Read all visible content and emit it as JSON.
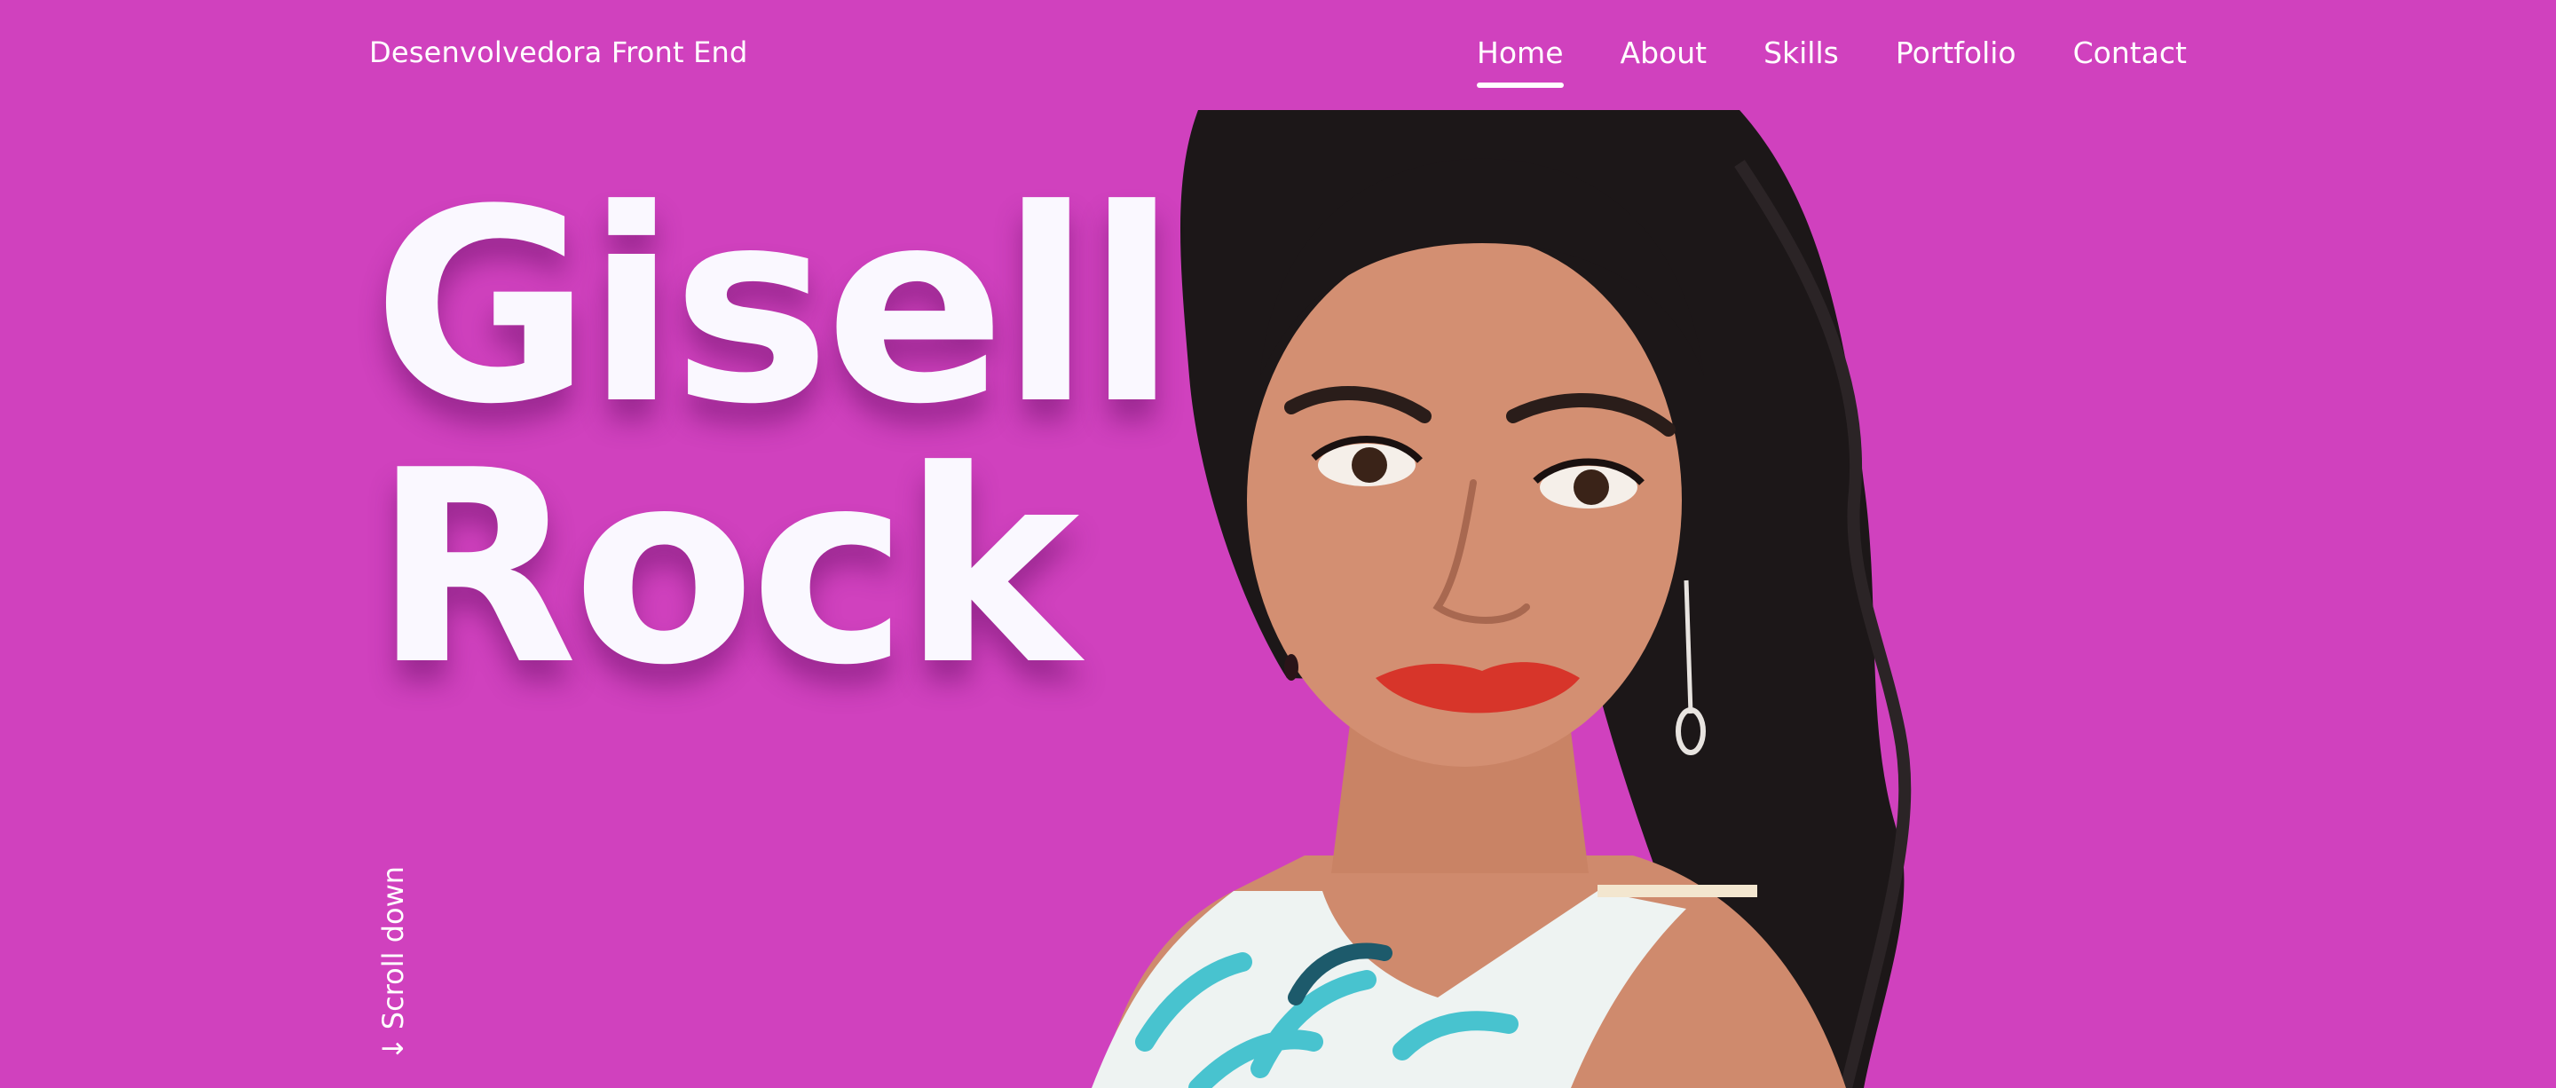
{
  "header": {
    "brand": "Desenvolvedora Front End",
    "nav": [
      {
        "label": "Home",
        "active": true
      },
      {
        "label": "About",
        "active": false
      },
      {
        "label": "Skills",
        "active": false
      },
      {
        "label": "Portfolio",
        "active": false
      },
      {
        "label": "Contact",
        "active": false
      }
    ]
  },
  "hero": {
    "first_name": "Gisell",
    "last_name": "Rock"
  },
  "scroll": {
    "arrow": "↓",
    "label": "Scroll down"
  },
  "colors": {
    "background": "#d041be",
    "text": "#ffffff",
    "hair": "#1c1718",
    "skin": "#d38f72",
    "lips": "#d7352a",
    "dress_accent": "#48c3cf"
  }
}
